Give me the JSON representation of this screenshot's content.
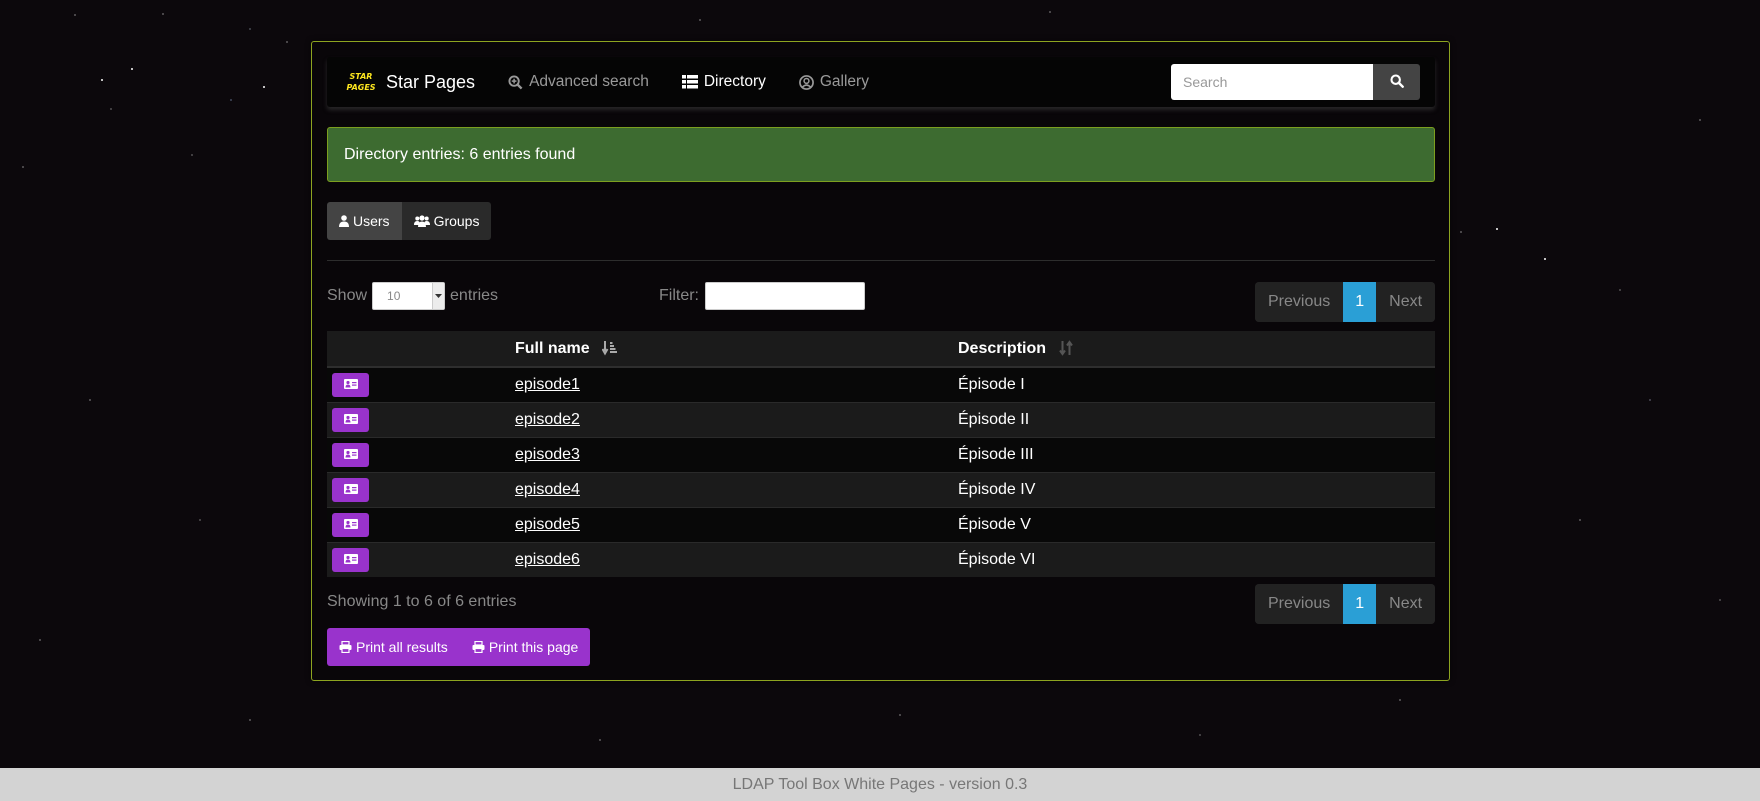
{
  "navbar": {
    "logo_line1": "STAR",
    "logo_line2": "PAGES",
    "brand": "Star Pages",
    "items": [
      {
        "label": "Advanced search",
        "icon": "search-plus-icon",
        "active": false
      },
      {
        "label": "Directory",
        "icon": "list-icon",
        "active": true
      },
      {
        "label": "Gallery",
        "icon": "user-circle-icon",
        "active": false
      }
    ],
    "search_placeholder": "Search",
    "search_value": ""
  },
  "alert": {
    "message": "Directory entries: 6 entries found",
    "color": "#3d6b30"
  },
  "tabs": [
    {
      "label": "Users",
      "icon": "user-icon",
      "active": true
    },
    {
      "label": "Groups",
      "icon": "users-icon",
      "active": false
    }
  ],
  "controls": {
    "show_label": "Show",
    "page_length": "10",
    "entries_label": "entries",
    "filter_label": "Filter:",
    "filter_value": ""
  },
  "pagination": {
    "previous": "Previous",
    "current": "1",
    "next": "Next",
    "accent": "#2a9fd6"
  },
  "table": {
    "columns": [
      "",
      "Full name",
      "Description"
    ],
    "rows": [
      {
        "name": "episode1",
        "description": "Épisode I"
      },
      {
        "name": "episode2",
        "description": "Épisode II"
      },
      {
        "name": "episode3",
        "description": "Épisode III"
      },
      {
        "name": "episode4",
        "description": "Épisode IV"
      },
      {
        "name": "episode5",
        "description": "Épisode V"
      },
      {
        "name": "episode6",
        "description": "Épisode VI"
      }
    ]
  },
  "info": "Showing 1 to 6 of 6 entries",
  "print": {
    "all_label": "Print all results",
    "page_label": "Print this page",
    "color": "#9933cc"
  },
  "footer": "LDAP Tool Box White Pages - version 0.3"
}
